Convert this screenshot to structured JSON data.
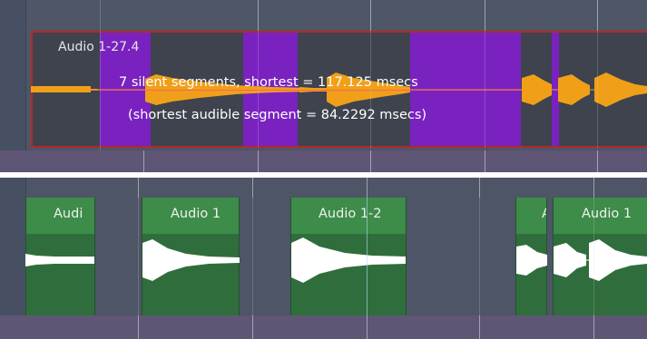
{
  "top_track": {
    "clip_title": "Audio 1-27.4",
    "status_line_1": "7 silent segments, shortest = 117.125 msecs",
    "status_line_2": "(shortest audible segment = 84.2292 msecs)",
    "colors": {
      "silence_highlight": "#7a22c0",
      "waveform": "#f0a018",
      "selection_border": "#b52828",
      "clip_background": "#3e434d"
    }
  },
  "bottom_track": {
    "clips": [
      {
        "label": "Audi"
      },
      {
        "label": "Audio 1"
      },
      {
        "label": "Audio 1-2"
      },
      {
        "label": "A"
      },
      {
        "label": "Audio 1"
      }
    ],
    "colors": {
      "clip_body": "#2f6e3c",
      "clip_header": "#3d8c49",
      "waveform": "#ffffff"
    }
  }
}
